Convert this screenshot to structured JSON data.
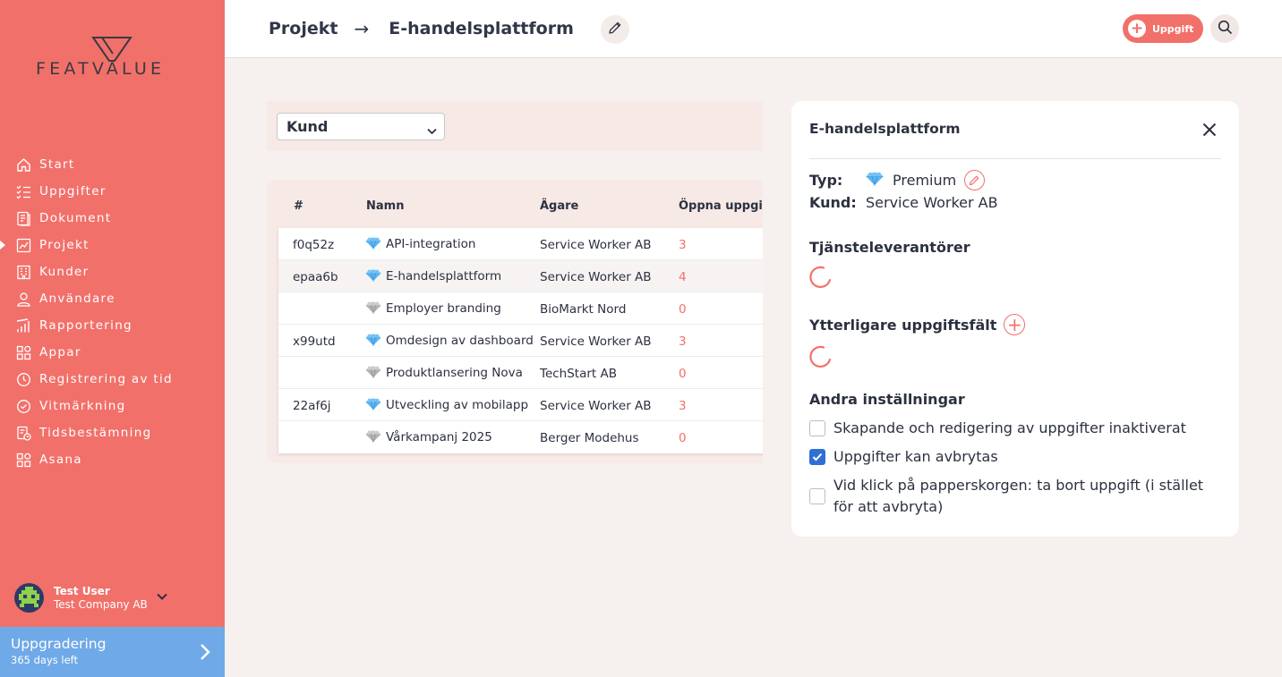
{
  "brand": {
    "logo_text": "FEATVALUE",
    "accent": "#f2706a",
    "upgrade_color": "#6fa9e8"
  },
  "sidebar": {
    "items": [
      {
        "label": "Start",
        "icon": "home-icon"
      },
      {
        "label": "Uppgifter",
        "icon": "checklist-icon"
      },
      {
        "label": "Dokument",
        "icon": "document-icon"
      },
      {
        "label": "Projekt",
        "icon": "chart-icon",
        "active": true
      },
      {
        "label": "Kunder",
        "icon": "building-icon"
      },
      {
        "label": "Användare",
        "icon": "user-icon"
      },
      {
        "label": "Rapportering",
        "icon": "bars-icon"
      },
      {
        "label": "Appar",
        "icon": "apps-icon"
      },
      {
        "label": "Registrering av tid",
        "icon": "timer-icon"
      },
      {
        "label": "Vitmärkning",
        "icon": "label-icon"
      },
      {
        "label": "Tidsbestämning",
        "icon": "schedule-icon"
      },
      {
        "label": "Asana",
        "icon": "apps-icon"
      }
    ],
    "user": {
      "name": "Test User",
      "company": "Test Company AB"
    },
    "upgrade": {
      "title": "Uppgradering",
      "subtitle": "365 days left"
    }
  },
  "header": {
    "breadcrumb_root": "Projekt",
    "breadcrumb_arrow": "→",
    "breadcrumb_current": "E-handelsplattform",
    "task_button": "Uppgift"
  },
  "filter": {
    "selected": "Kund"
  },
  "table": {
    "headers": [
      "#",
      "Namn",
      "Ägare",
      "Öppna uppgifter"
    ],
    "rows": [
      {
        "id": "f0q52z",
        "name": "API-integration",
        "tier": "premium",
        "owner": "Service Worker AB",
        "open": "3"
      },
      {
        "id": "epaa6b",
        "name": "E-handelsplattform",
        "tier": "premium",
        "owner": "Service Worker AB",
        "open": "4"
      },
      {
        "id": "",
        "name": "Employer branding",
        "tier": "standard",
        "owner": "BioMarkt Nord",
        "open": "0"
      },
      {
        "id": "x99utd",
        "name": "Omdesign av dashboard",
        "tier": "premium",
        "owner": "Service Worker AB",
        "open": "3"
      },
      {
        "id": "",
        "name": "Produktlansering Nova",
        "tier": "standard",
        "owner": "TechStart AB",
        "open": "0"
      },
      {
        "id": "22af6j",
        "name": "Utveckling av mobilapp",
        "tier": "premium",
        "owner": "Service Worker AB",
        "open": "3"
      },
      {
        "id": "",
        "name": "Vårkampanj 2025",
        "tier": "standard",
        "owner": "Berger Modehus",
        "open": "0"
      }
    ]
  },
  "panel": {
    "title": "E-handelsplattform",
    "type_label": "Typ:",
    "type_value": "Premium",
    "customer_label": "Kund:",
    "customer_value": "Service Worker AB",
    "providers_title": "Tjänsteleverantörer",
    "extra_fields_title": "Ytterligare uppgiftsfält",
    "other_settings_title": "Andra inställningar",
    "settings": [
      {
        "label": "Skapande och redigering av uppgifter inaktiverat",
        "checked": false
      },
      {
        "label": "Uppgifter kan avbrytas",
        "checked": true
      },
      {
        "label": "Vid klick på papperskorgen: ta bort uppgift (i stället",
        "label2": "för att avbryta)",
        "checked": false
      }
    ]
  }
}
